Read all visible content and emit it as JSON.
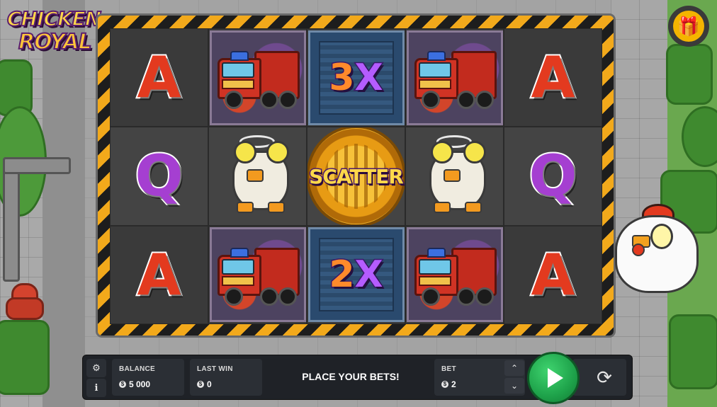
{
  "game": {
    "logo_line1": "CHICKEN",
    "logo_line2": "ROYAL"
  },
  "top_right": {
    "icon": "gift-icon"
  },
  "reels": [
    [
      "A",
      "Q",
      "A"
    ],
    [
      "fire-truck",
      "ghost-chicken",
      "fire-truck"
    ],
    [
      "3X",
      "SCATTER",
      "2X"
    ],
    [
      "fire-truck",
      "ghost-chicken",
      "fire-truck"
    ],
    [
      "A",
      "Q",
      "A"
    ]
  ],
  "symbols": {
    "a": "A",
    "q": "Q",
    "mult_top_num": "3",
    "mult_bottom_num": "2",
    "mult_x": "X",
    "scatter": "SCATTER"
  },
  "bottom_bar": {
    "settings_icon": "gear-icon",
    "info_icon": "info-icon",
    "info_glyph": "i",
    "settings_glyph": "⚙",
    "balance_label": "BALANCE",
    "balance_value": "5 000",
    "last_win_label": "LAST WIN",
    "last_win_value": "0",
    "message": "PLACE YOUR BETS!",
    "bet_label": "BET",
    "bet_value": "2",
    "currency_glyph": "$",
    "up_glyph": "⌃",
    "down_glyph": "⌄",
    "autoplay_glyph": "⟳",
    "spin_icon": "play-icon",
    "autoplay_icon": "autoplay-icon"
  },
  "colors": {
    "frame_stripe_yellow": "#f2a91b",
    "frame_stripe_black": "#1d1d1d",
    "spin_green": "#1ea24a",
    "letter_a": "#e33a1f",
    "letter_q": "#a53fd1"
  }
}
